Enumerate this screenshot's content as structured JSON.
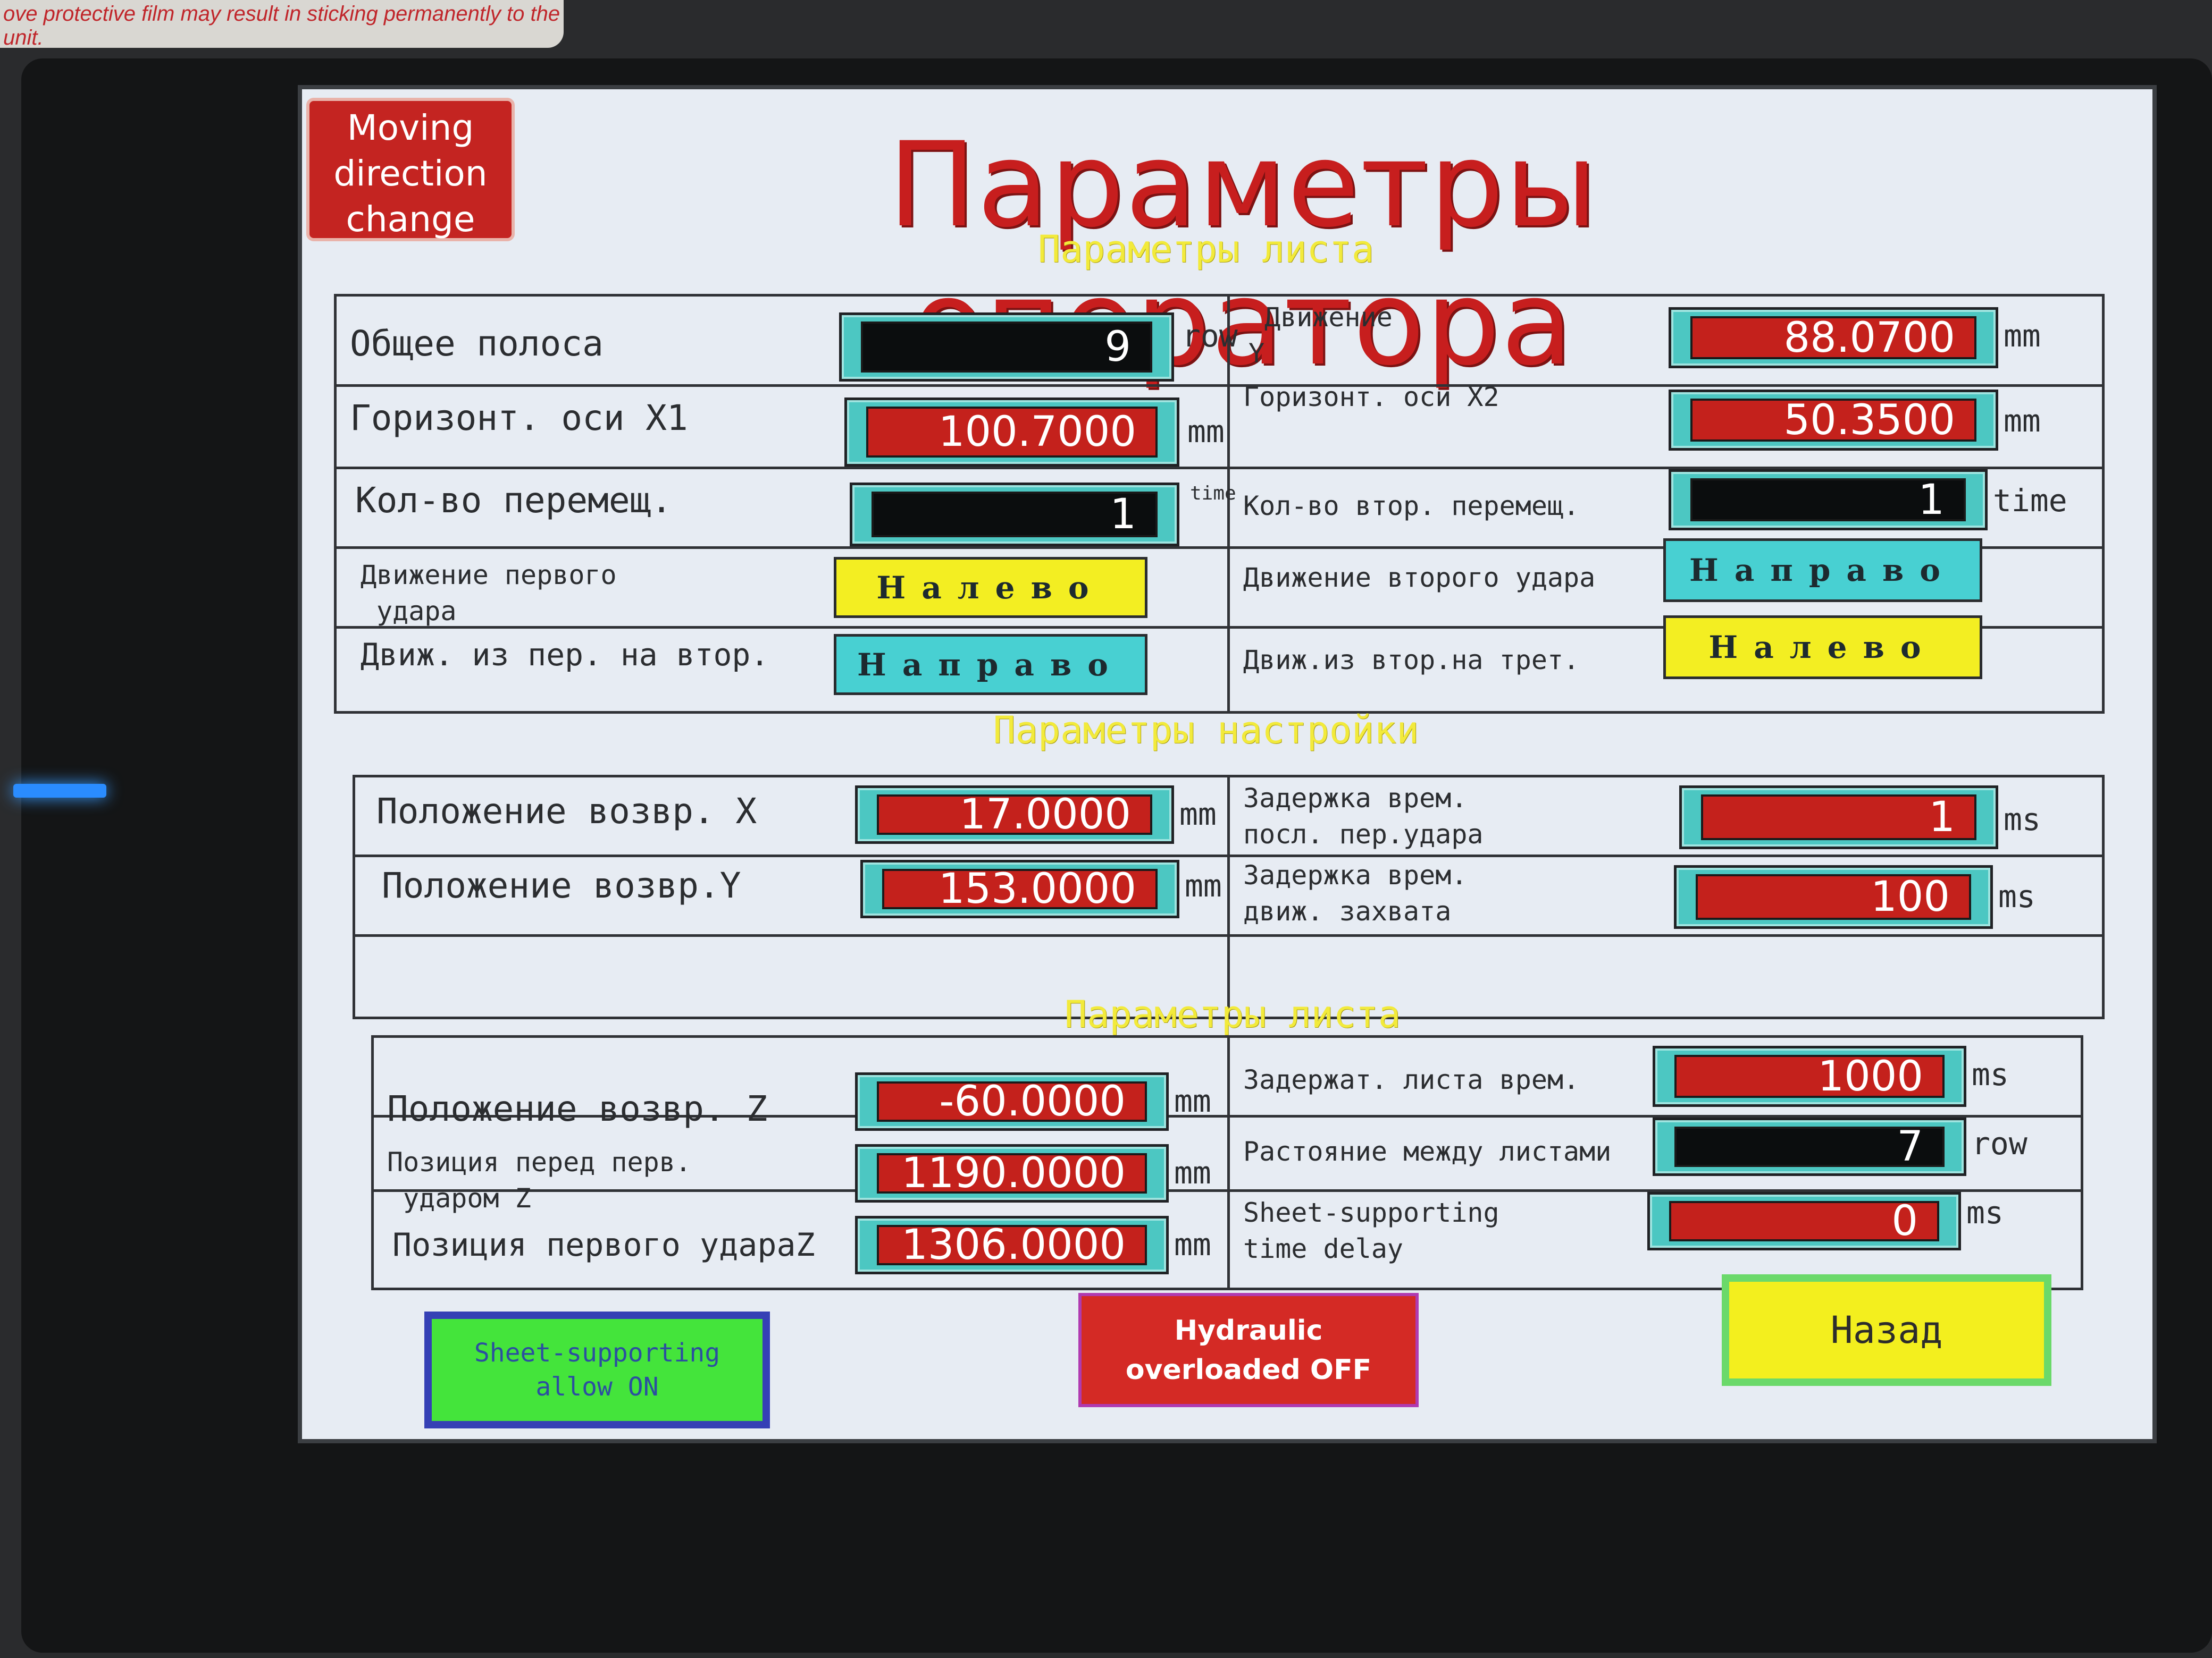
{
  "sticker_text": "ove protective film may result in sticking permanently to the unit.",
  "title": "Параметры оператора",
  "move_button": {
    "line1": "Moving",
    "line2": "direction",
    "line3": "change"
  },
  "sections": {
    "sheet1": "Параметры листа",
    "setup": "Параметры настройки",
    "sheet2": "Параметры листа"
  },
  "block1": {
    "left": [
      {
        "label": "Общее полоса",
        "value": "9",
        "unit": "row",
        "style": "black"
      },
      {
        "label": "Горизонт. оси X1",
        "value": "100.7000",
        "unit": "mm",
        "style": "red"
      },
      {
        "label": "Кол-во перемещ.",
        "value": "1",
        "unit": "time",
        "style": "black"
      },
      {
        "label_l1": "Движение первого",
        "label_l2": "удара",
        "value": "Налево",
        "style": "yellow"
      },
      {
        "label": "Движ. из пер. на втор.",
        "value": "Направо",
        "style": "cyan"
      }
    ],
    "right": [
      {
        "label_l1": "Движение",
        "label_l2": "Y",
        "value": "88.0700",
        "unit": "mm",
        "style": "red"
      },
      {
        "label": "Горизонт. оси X2",
        "value": "50.3500",
        "unit": "mm",
        "style": "red"
      },
      {
        "label": "Кол-во втор. перемещ.",
        "value": "1",
        "unit": "time",
        "style": "black"
      },
      {
        "label": "Движение второго удара",
        "value": "Направо",
        "style": "cyan"
      },
      {
        "label": "Движ.из втор.на трет.",
        "value": "Налево",
        "style": "yellow"
      }
    ]
  },
  "block2": {
    "left": [
      {
        "label": "Положение возвр. X",
        "value": "17.0000",
        "unit": "mm"
      },
      {
        "label": "Положение возвр.Y",
        "value": "153.0000",
        "unit": "mm"
      }
    ],
    "right": [
      {
        "label_l1": "Задержка врем.",
        "label_l2": "посл. пер.удара",
        "value": "1",
        "unit": "ms"
      },
      {
        "label_l1": "Задержка врем.",
        "label_l2": "движ. захвата",
        "value": "100",
        "unit": "ms"
      }
    ]
  },
  "block3": {
    "left": [
      {
        "label": "Положение возвр. Z",
        "value": "-60.0000",
        "unit": "mm"
      },
      {
        "label_l1": "Позиция перед перв.",
        "label_l2": "ударом Z",
        "value": "1190.0000",
        "unit": "mm"
      },
      {
        "label": "Позиция первого удараZ",
        "value": "1306.0000",
        "unit": "mm"
      }
    ],
    "right": [
      {
        "label": "Задержат. листа врем.",
        "value": "1000",
        "unit": "ms",
        "style": "red"
      },
      {
        "label": "Растояние между листами",
        "value": "7",
        "unit": "row",
        "style": "black"
      },
      {
        "label_l1": "Sheet-supporting",
        "label_l2": "time delay",
        "value": "0",
        "unit": "ms",
        "style": "red"
      }
    ]
  },
  "buttons": {
    "sheet_support_l1": "Sheet-supporting",
    "sheet_support_l2": "allow ON",
    "hydraulic_l1": "Hydraulic",
    "hydraulic_l2": "overloaded OFF",
    "back": "Назад"
  }
}
